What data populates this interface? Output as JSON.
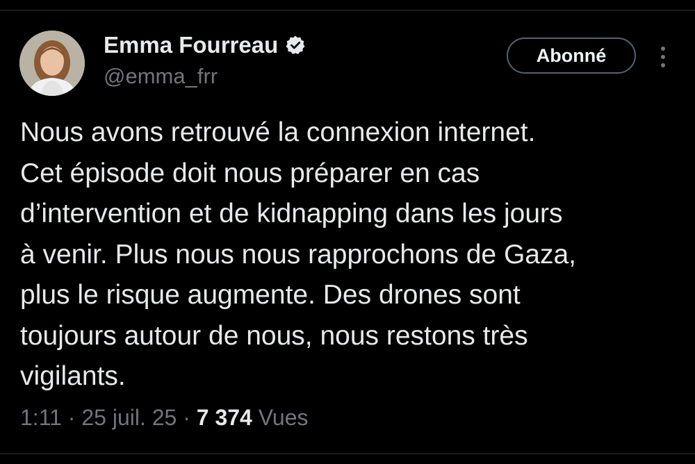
{
  "author": {
    "name": "Emma Fourreau",
    "handle": "@emma_frr",
    "verified_icon": "verified-badge-icon"
  },
  "follow_button": {
    "label": "Abonné"
  },
  "more_menu": {
    "icon": "more-vertical-icon"
  },
  "tweet": {
    "lines": [
      "Nous avons retrouvé la connexion internet.",
      "Cet épisode doit nous préparer en cas",
      "d’intervention et de kidnapping dans les jours",
      "à venir. Plus nous nous rapprochons de Gaza,",
      "plus le risque augmente. Des drones sont",
      "toujours autour de nous, nous restons très",
      "vigilants."
    ]
  },
  "meta": {
    "time": "1:11",
    "separator": "·",
    "date": "25 juil. 25",
    "views_count": "7 374",
    "views_label": "Vues"
  },
  "colors": {
    "background": "#000000",
    "text_primary": "#e7e9ea",
    "text_secondary": "#71767b",
    "border": "#536471"
  }
}
